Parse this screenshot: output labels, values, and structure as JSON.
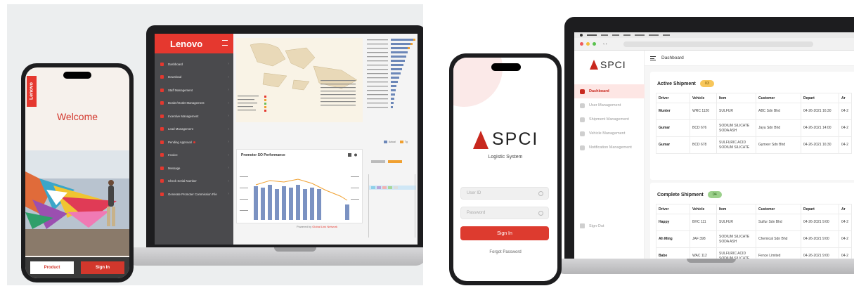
{
  "lenovo": {
    "laptop": {
      "brand": "Lenovo",
      "menu": [
        {
          "label": "Dashboard"
        },
        {
          "label": "Download"
        },
        {
          "label": "Staff Management"
        },
        {
          "label": "Dealer/Outlet Management"
        },
        {
          "label": "Incentive Management"
        },
        {
          "label": "Lead Management"
        },
        {
          "label": "Pending Approval",
          "alert": true
        },
        {
          "label": "Invoice"
        },
        {
          "label": "Message"
        },
        {
          "label": "Check Serial Number"
        },
        {
          "label": "Generate Promoter Commission File"
        }
      ],
      "promoter_card_title": "Promoter SO Performance",
      "powered_prefix": "Powered by",
      "powered_brand": "Global Link Network",
      "legend": [
        "Actual",
        "Tg"
      ],
      "accent": "#e5382f"
    },
    "phone": {
      "badge": "Lenovo",
      "welcome": "Welcome",
      "product_button": "Product",
      "signin_button": "Sign In"
    }
  },
  "spci": {
    "laptop": {
      "logo_text": "SPCI",
      "header_title": "Dashboard",
      "nav": [
        {
          "label": "Dashboard",
          "active": true
        },
        {
          "label": "User Management"
        },
        {
          "label": "Shipment Management"
        },
        {
          "label": "Vehicle Management"
        },
        {
          "label": "Notification Management"
        }
      ],
      "signout": "Sign Out",
      "active_shipment": {
        "title": "Active Shipment",
        "count": "03",
        "columns": [
          "Driver",
          "Vehicle",
          "Item",
          "Customer",
          "Depart",
          "Ar"
        ],
        "rows": [
          [
            "Munter",
            "WRC 1120",
            "SULFUR",
            "ABC Sdn Bhd",
            "04-26-2021 16:30",
            "04-2"
          ],
          [
            "Gumar",
            "BCD 676",
            "SODIUM SILICATE SODA ASH",
            "Jaya Sdn Bhd",
            "04-26-2021 14:00",
            "04-2"
          ],
          [
            "Gumar",
            "BCD 678",
            "SULFURIC ACID SODIUM SILICATE",
            "Gymxer Sdn Bhd",
            "04-26-2021 16:30",
            "04-2"
          ]
        ]
      },
      "complete_shipment": {
        "title": "Complete Shipment",
        "count": "04",
        "columns": [
          "Driver",
          "Vehicle",
          "Item",
          "Customer",
          "Depart",
          "Ar"
        ],
        "rows": [
          [
            "Happy",
            "BHC 111",
            "SULFUR",
            "Sulfur Sdn Bhd",
            "04-26-2021 9:00",
            "04-2"
          ],
          [
            "Ah Ming",
            "JAF 398",
            "SODIUM SILICATE SODA ASH",
            "Chemical Sdn Bhd",
            "04-26-2021 9:00",
            "04-2"
          ],
          [
            "Babe",
            "WAC 112",
            "SULFURIC ACID SODIUM SILICATE",
            "Fence Limited",
            "04-26-2021 9:00",
            "04-2"
          ]
        ]
      },
      "accent": "#c8281e"
    },
    "phone": {
      "logo_text": "SPCI",
      "subtitle": "Logistic System",
      "user_placeholder": "User ID",
      "password_placeholder": "Password",
      "signin_button": "Sign In",
      "forgot": "Forgot Password"
    }
  }
}
